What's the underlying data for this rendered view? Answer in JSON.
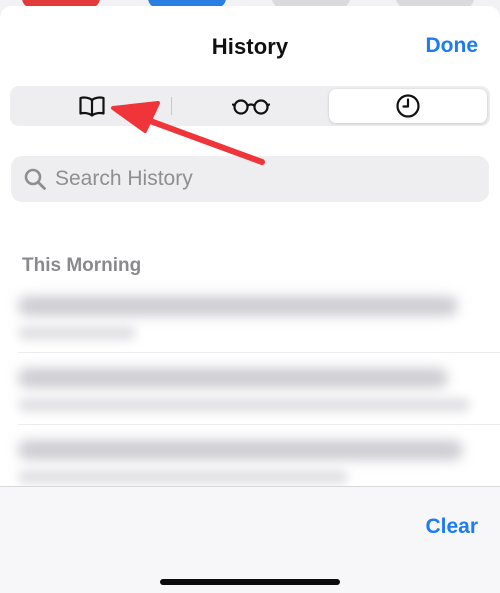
{
  "header": {
    "title": "History",
    "done_label": "Done"
  },
  "segmented_control": {
    "segments": [
      {
        "name": "bookmarks",
        "icon": "book-icon"
      },
      {
        "name": "reading-list",
        "icon": "glasses-icon"
      },
      {
        "name": "history",
        "icon": "clock-icon"
      }
    ],
    "selected_index": 2
  },
  "search": {
    "placeholder": "Search History",
    "value": ""
  },
  "section": {
    "title": "This Morning"
  },
  "toolbar": {
    "clear_label": "Clear"
  },
  "colors": {
    "accent": "#1d7cf2",
    "annotation_arrow": "#f0353a",
    "segment_bg": "#eeeef0",
    "section_header": "#8a8a8e"
  }
}
